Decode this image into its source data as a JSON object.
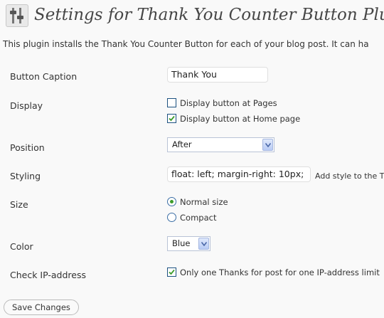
{
  "header": {
    "title": "Settings for Thank You Counter Button Plugin",
    "icon": "settings-sliders-icon"
  },
  "intro": "This plugin installs the Thank You Counter Button for each of your blog post. It can ha",
  "fields": {
    "caption": {
      "label": "Button Caption",
      "value": "Thank You"
    },
    "display": {
      "label": "Display",
      "options": [
        {
          "label": "Display button at Pages",
          "checked": false
        },
        {
          "label": "Display button at Home page",
          "checked": true
        }
      ]
    },
    "position": {
      "label": "Position",
      "selected": "After"
    },
    "styling": {
      "label": "Styling",
      "value": "float: left; margin-right: 10px;",
      "hint": "Add style to the T"
    },
    "size": {
      "label": "Size",
      "options": [
        {
          "label": "Normal size",
          "selected": true
        },
        {
          "label": "Compact",
          "selected": false
        }
      ]
    },
    "color": {
      "label": "Color",
      "selected": "Blue"
    },
    "ip": {
      "label": "Check IP-address",
      "option": {
        "label": "Only one Thanks for post for one IP-address limit",
        "checked": true
      }
    }
  },
  "save_label": "Save Changes",
  "colors": {
    "background": "#f9f9f9",
    "check": "#3c9c2a",
    "select_arrow": "#4b68a8"
  }
}
